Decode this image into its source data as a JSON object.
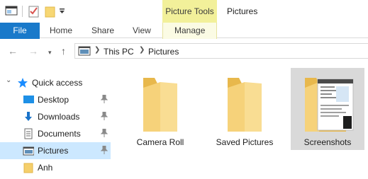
{
  "titlebar": {
    "contextual_group": "Picture Tools",
    "window_title": "Pictures"
  },
  "ribbon": {
    "tabs": [
      {
        "label": "File",
        "active": true
      },
      {
        "label": "Home"
      },
      {
        "label": "Share"
      },
      {
        "label": "View"
      },
      {
        "label": "Manage"
      }
    ]
  },
  "address": {
    "breadcrumbs": [
      "This PC",
      "Pictures"
    ]
  },
  "navpane": {
    "items": [
      {
        "label": "Quick access",
        "icon": "star-icon"
      },
      {
        "label": "Desktop",
        "icon": "desktop-icon",
        "pinned": true
      },
      {
        "label": "Downloads",
        "icon": "download-icon",
        "pinned": true
      },
      {
        "label": "Documents",
        "icon": "documents-icon",
        "pinned": true
      },
      {
        "label": "Pictures",
        "icon": "pictures-icon",
        "pinned": true,
        "selected": true
      },
      {
        "label": "Anh",
        "icon": "folder-icon"
      }
    ]
  },
  "content": {
    "items": [
      {
        "label": "Camera Roll",
        "icon": "folder-icon"
      },
      {
        "label": "Saved Pictures",
        "icon": "folder-icon"
      },
      {
        "label": "Screenshots",
        "icon": "folder-with-preview-icon",
        "selected": true
      }
    ]
  },
  "colors": {
    "file_tab": "#1979ca",
    "contextual_tab": "#f2f09a",
    "selection": "#cce8ff",
    "folder": "#f5cf6b",
    "quick_access_star": "#1a8cff"
  }
}
